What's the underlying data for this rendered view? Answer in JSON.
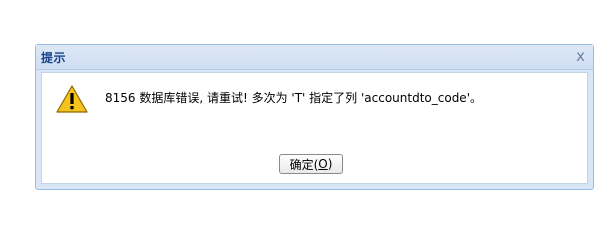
{
  "dialog": {
    "title": "提示",
    "close_symbol": "x",
    "icon": "warning-icon",
    "message": "8156 数据库错误, 请重试! 多次为 'T' 指定了列 'accountdto_code'。",
    "ok_button": {
      "label_prefix": "确定(",
      "mnemonic": "O",
      "label_suffix": ")"
    }
  }
}
